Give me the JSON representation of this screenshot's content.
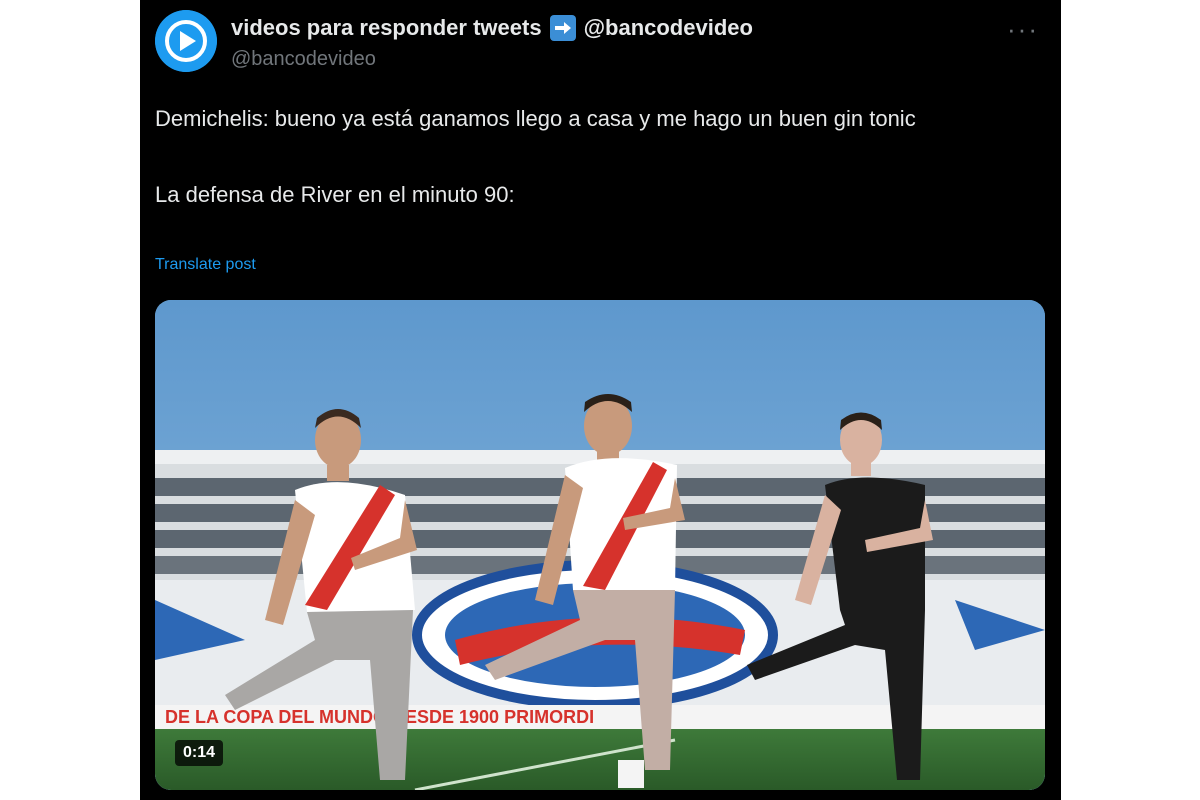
{
  "author": {
    "display_name": "videos para responder tweets",
    "linked_handle": "@bancodevideo",
    "handle": "@bancodevideo"
  },
  "menu": {
    "more_label": "···"
  },
  "tweet": {
    "line1": "Demichelis: bueno ya está ganamos llego a casa y me hago un buen gin tonic",
    "line2": "La defensa de River en el minuto 90:",
    "translate_label": "Translate post"
  },
  "video": {
    "duration": "0:14",
    "banner_text": "DE LA COPA DEL MUNDO        DESDE 1900        PRIMORDI",
    "banner_text_color": "#d6322c"
  },
  "colors": {
    "accent": "#1d9bf0",
    "background": "#000000",
    "text": "#e7e9ea",
    "muted": "#71767b"
  },
  "icons": {
    "avatar": "play-icon",
    "arrow": "right-arrow-emoji"
  }
}
